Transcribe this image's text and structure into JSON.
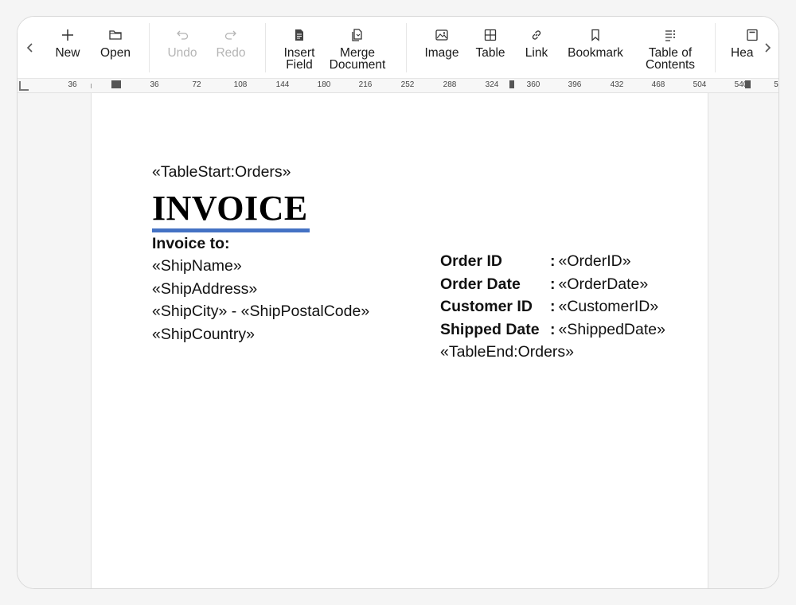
{
  "toolbar": {
    "buttons": [
      {
        "label": "New",
        "icon": "plus-icon",
        "enabled": true
      },
      {
        "label": "Open",
        "icon": "folder-icon",
        "enabled": true
      },
      {
        "label": "Undo",
        "icon": "undo-icon",
        "enabled": false
      },
      {
        "label": "Redo",
        "icon": "redo-icon",
        "enabled": false
      },
      {
        "label": "Insert\nField",
        "icon": "insert-field-icon",
        "enabled": true
      },
      {
        "label": "Merge\nDocument",
        "icon": "merge-document-icon",
        "enabled": true
      },
      {
        "label": "Image",
        "icon": "image-icon",
        "enabled": true
      },
      {
        "label": "Table",
        "icon": "table-icon",
        "enabled": true
      },
      {
        "label": "Link",
        "icon": "link-icon",
        "enabled": true
      },
      {
        "label": "Bookmark",
        "icon": "bookmark-icon",
        "enabled": true
      },
      {
        "label": "Table of\nContents",
        "icon": "toc-icon",
        "enabled": true
      },
      {
        "label": "Hea",
        "icon": "header-icon",
        "enabled": true
      }
    ],
    "left_arrow": "chevron-left-icon",
    "right_arrow": "chevron-right-icon"
  },
  "ruler": {
    "labels": [
      "36",
      "36",
      "72",
      "108",
      "144",
      "180",
      "216",
      "252",
      "288",
      "324",
      "360",
      "396",
      "432",
      "468",
      "504",
      "540",
      "5"
    ]
  },
  "document": {
    "table_start": "«TableStart:Orders»",
    "title": "INVOICE",
    "invoice_to_label": "Invoice to:",
    "address_lines": [
      "«ShipName»",
      "«ShipAddress»",
      "«ShipCity» - «ShipPostalCode»",
      "«ShipCountry»"
    ],
    "fields": [
      {
        "key": "Order ID",
        "value": "«OrderID»"
      },
      {
        "key": "Order Date",
        "value": "«OrderDate»"
      },
      {
        "key": "Customer ID",
        "value": "«CustomerID»"
      },
      {
        "key": "Shipped Date",
        "value": "«ShippedDate»"
      }
    ],
    "separator": ":",
    "table_end": "«TableEnd:Orders»"
  },
  "colors": {
    "accent_underline": "#4472c4",
    "disabled_text": "#b5b5b5"
  }
}
